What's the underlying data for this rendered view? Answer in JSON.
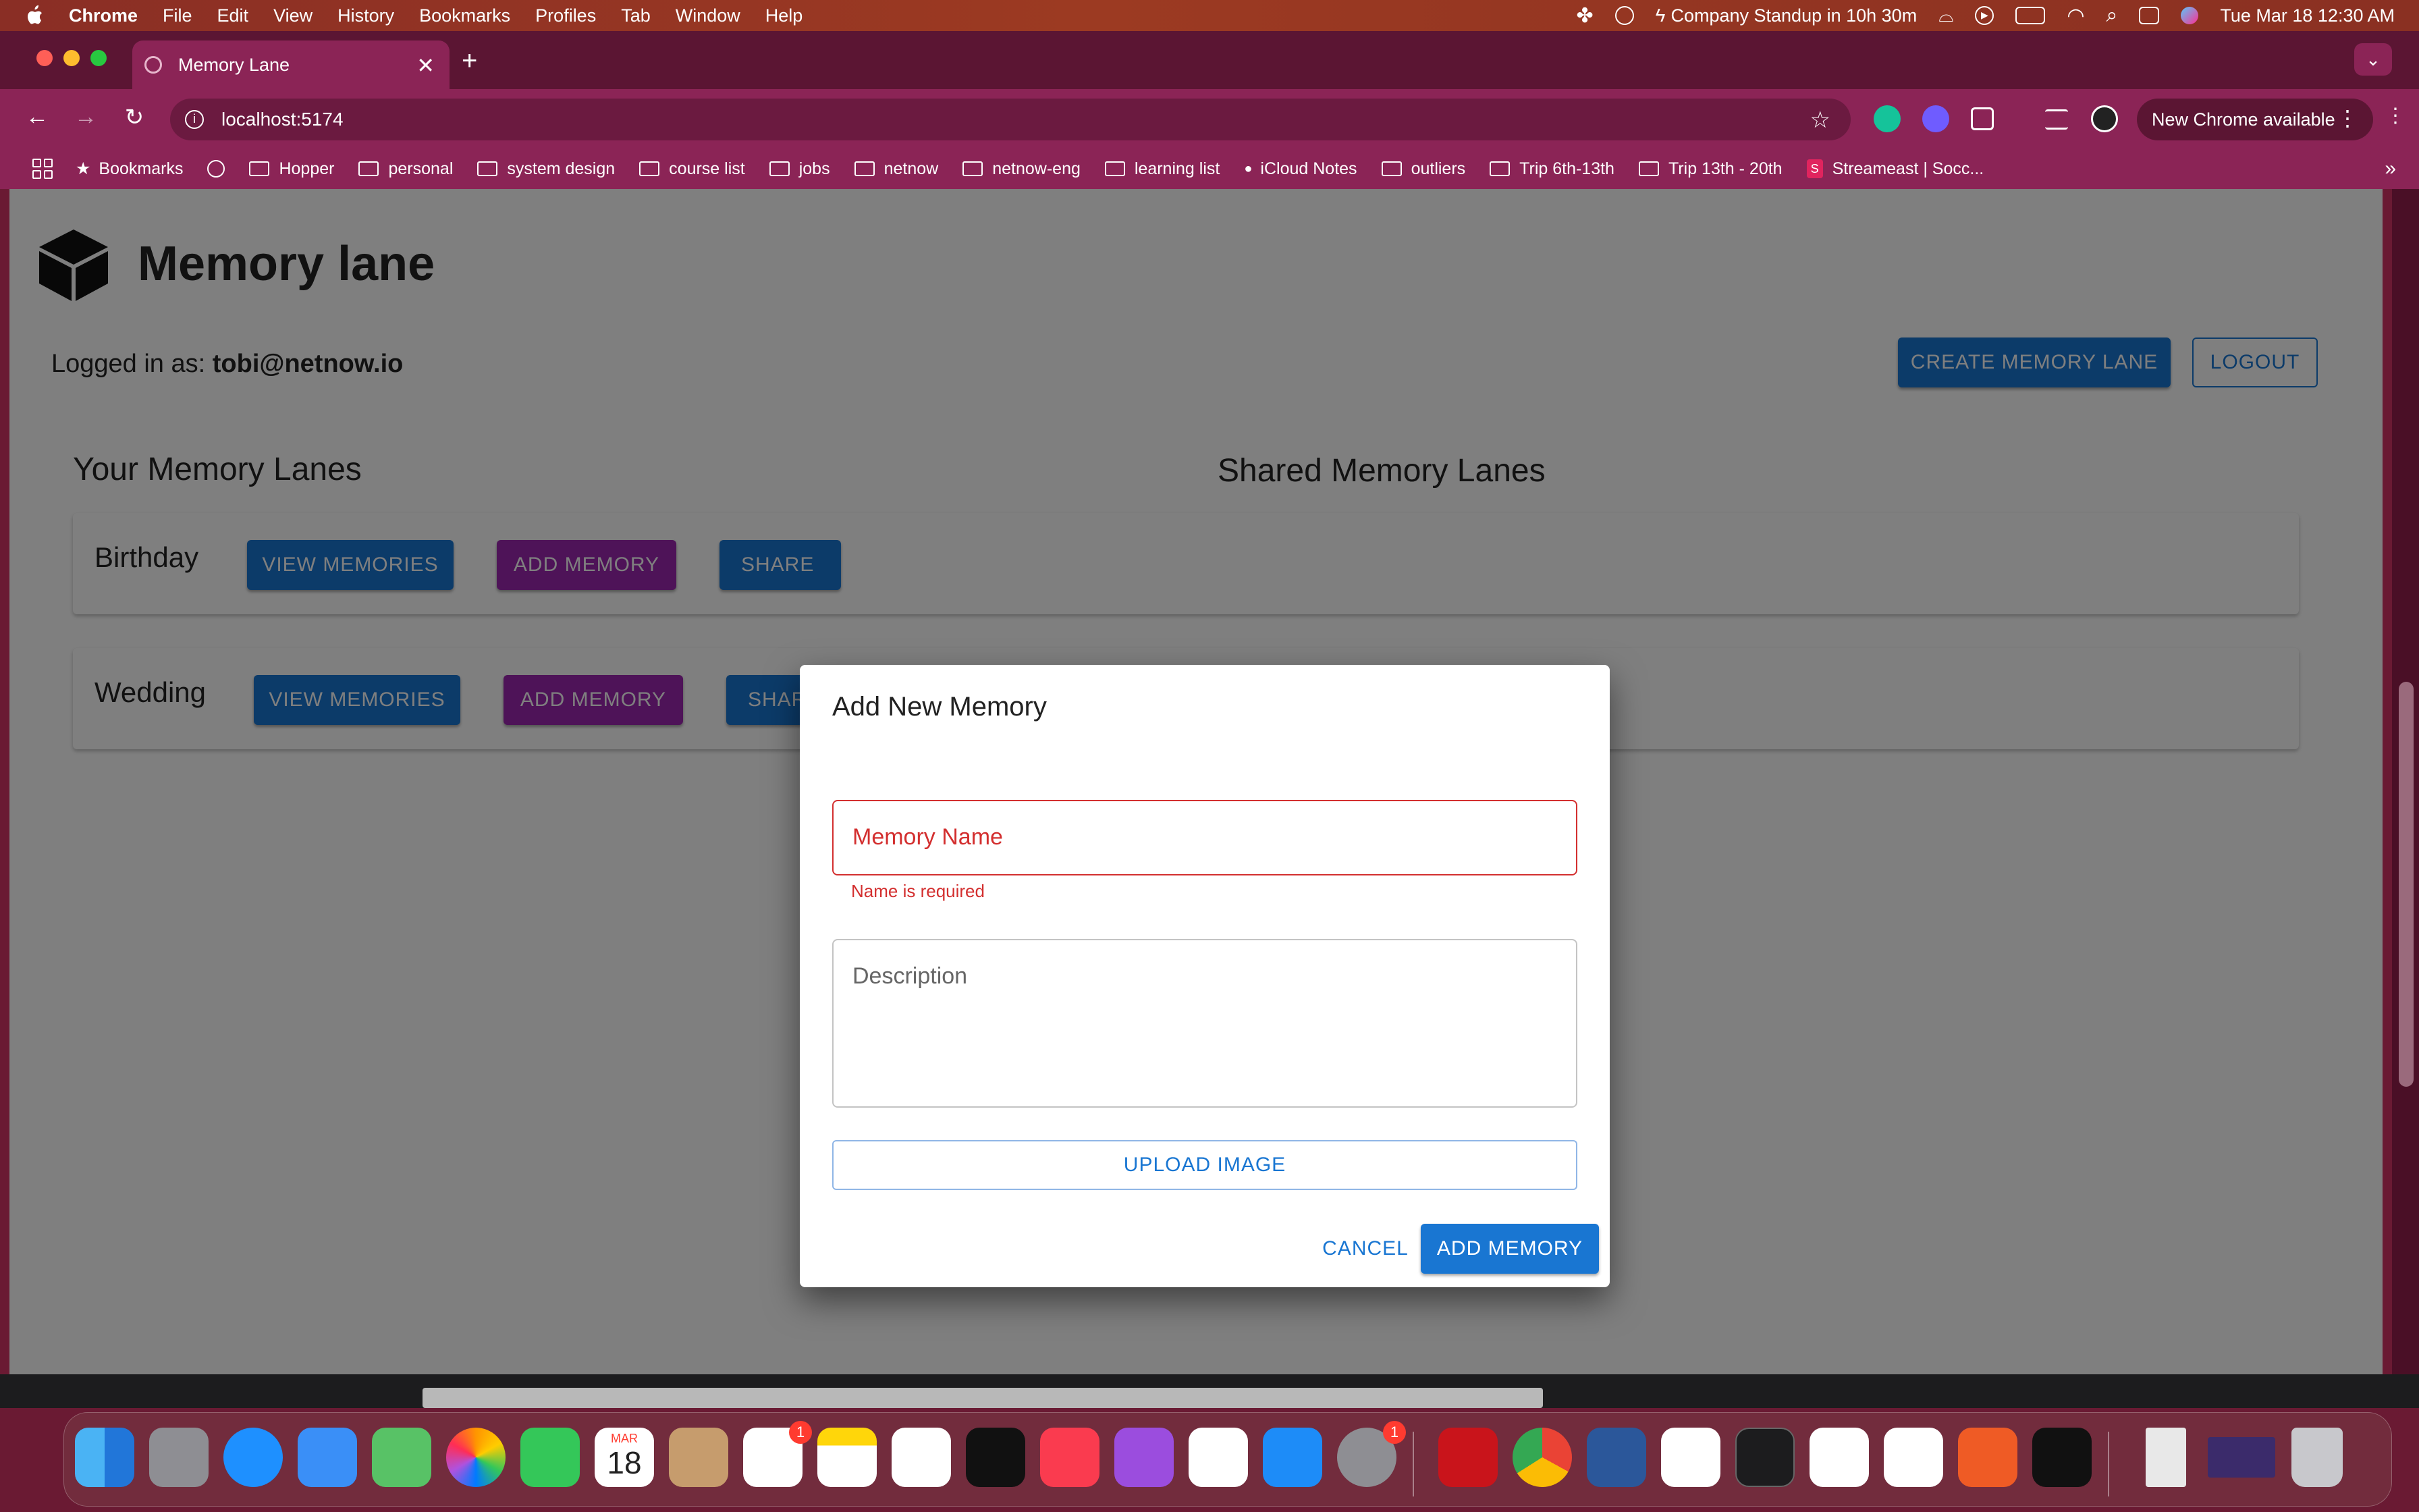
{
  "menubar": {
    "app_name": "Chrome",
    "items": [
      "File",
      "Edit",
      "View",
      "History",
      "Bookmarks",
      "Profiles",
      "Tab",
      "Window",
      "Help"
    ],
    "calendar_event": "Company Standup in 10h 30m",
    "datetime": "Tue Mar 18  12:30 AM"
  },
  "browser": {
    "tab_title": "Memory Lane",
    "url": "localhost:5174",
    "update_label": "New Chrome available",
    "bookmarks": [
      {
        "label": "Bookmarks",
        "icon": "star-icon"
      },
      {
        "label": "Hopper",
        "icon": "folder-icon"
      },
      {
        "label": "personal",
        "icon": "folder-icon"
      },
      {
        "label": "system design",
        "icon": "folder-icon"
      },
      {
        "label": "course list",
        "icon": "folder-icon"
      },
      {
        "label": "jobs",
        "icon": "folder-icon"
      },
      {
        "label": "netnow",
        "icon": "folder-icon"
      },
      {
        "label": "netnow-eng",
        "icon": "folder-icon"
      },
      {
        "label": "learning list",
        "icon": "folder-icon"
      },
      {
        "label": "iCloud Notes",
        "icon": "apple-icon"
      },
      {
        "label": "outliers",
        "icon": "folder-icon"
      },
      {
        "label": "Trip 6th-13th",
        "icon": "folder-icon"
      },
      {
        "label": "Trip 13th - 20th",
        "icon": "folder-icon"
      },
      {
        "label": "Streameast | Socc...",
        "icon": "streameast-icon"
      }
    ]
  },
  "app": {
    "title": "Memory lane",
    "logged_in_prefix": "Logged in as: ",
    "user_email": "tobi@netnow.io",
    "create_button": "CREATE MEMORY LANE",
    "logout_button": "LOGOUT",
    "your_lanes_title": "Your Memory Lanes",
    "shared_lanes_title": "Shared Memory Lanes",
    "lanes": [
      {
        "name": "Birthday",
        "view_label": "VIEW MEMORIES",
        "add_label": "ADD MEMORY",
        "share_label": "SHARE"
      },
      {
        "name": "Wedding",
        "view_label": "VIEW MEMORIES",
        "add_label": "ADD MEMORY",
        "share_label": "SHARE"
      }
    ]
  },
  "dialog": {
    "title": "Add New Memory",
    "name_label": "Memory Name",
    "name_error": "Name is required",
    "description_label": "Description",
    "upload_label": "UPLOAD IMAGE",
    "cancel_label": "CANCEL",
    "submit_label": "ADD MEMORY"
  },
  "dock": {
    "calendar_month": "MAR",
    "calendar_day": "18",
    "reminders_badge": "1",
    "settings_badge": "1",
    "apps": [
      "finder",
      "launchpad",
      "safari",
      "mail",
      "maps",
      "photos",
      "facetime",
      "calendar",
      "contacts",
      "reminders",
      "notes",
      "freeform",
      "tv",
      "music",
      "podcasts",
      "news",
      "app-store",
      "system-settings",
      "acrobat",
      "chrome",
      "word",
      "slack",
      "terminal",
      "asana",
      "vscode",
      "postman",
      "cursor"
    ]
  },
  "colors": {
    "primary": "#1976d2",
    "secondary": "#9c27b0",
    "error": "#d32f2f",
    "browser_frame": "#8b2456"
  }
}
